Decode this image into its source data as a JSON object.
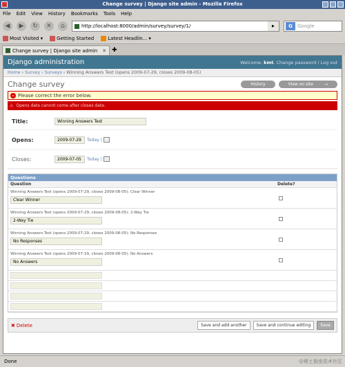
{
  "window": {
    "title": "Change survey | Django site admin - Mozilla Firefox"
  },
  "menu": [
    "File",
    "Edit",
    "View",
    "History",
    "Bookmarks",
    "Tools",
    "Help"
  ],
  "nav": {
    "url": "http://localhost:8000/admin/survey/survey/1/",
    "search_placeholder": "Google"
  },
  "bookmarks": [
    "Most Visited",
    "Getting Started",
    "Latest Headlin..."
  ],
  "tab": {
    "label": "Change survey | Django site admin"
  },
  "dj": {
    "site_name": "Django administration",
    "welcome": "Welcome,",
    "user": "kmt",
    "change_password": "Change password",
    "separator": "/",
    "logout": "Log out"
  },
  "breadcrumbs": {
    "home": "Home",
    "app": "Survey",
    "model": "Surveys",
    "current": "Winning Answers Test (opens 2009-07-29, closes 2009-08-05)",
    "sep": "›"
  },
  "page": {
    "title": "Change survey",
    "history": "History",
    "view_on_site": "View on site"
  },
  "errors": {
    "note": "Please correct the error below.",
    "item": "Opens date cannot come after closes date."
  },
  "form": {
    "title_label": "Title:",
    "title_value": "Winning Answers Test",
    "opens_label": "Opens:",
    "opens_value": "2009-07-29",
    "closes_label": "Closes:",
    "closes_value": "2009-07-05",
    "today": "Today"
  },
  "inline": {
    "heading": "Questions",
    "col_question": "Question",
    "col_delete": "Delete?",
    "rows": [
      {
        "original": "Winning Answers Test (opens 2009-07-29, closes 2009-08-05): Clear Winner",
        "value": "Clear Winner"
      },
      {
        "original": "Winning Answers Test (opens 2009-07-29, closes 2009-08-05): 2-Way Tie",
        "value": "2-Way Tie"
      },
      {
        "original": "Winning Answers Test (opens 2009-07-29, closes 2009-08-05): No Responses",
        "value": "No Responses"
      },
      {
        "original": "Winning Answers Test (opens 2009-07-29, closes 2009-08-05): No Answers",
        "value": "No Answers"
      }
    ]
  },
  "submit": {
    "delete": "Delete",
    "save_add": "Save and add another",
    "save_continue": "Save and continue editing",
    "save": "Save"
  },
  "status": {
    "text": "Done",
    "watermark": "@稀土掘金技术社区"
  },
  "colors": {
    "header": "#417690",
    "module": "#7ca0c7",
    "error": "#cc0000"
  }
}
